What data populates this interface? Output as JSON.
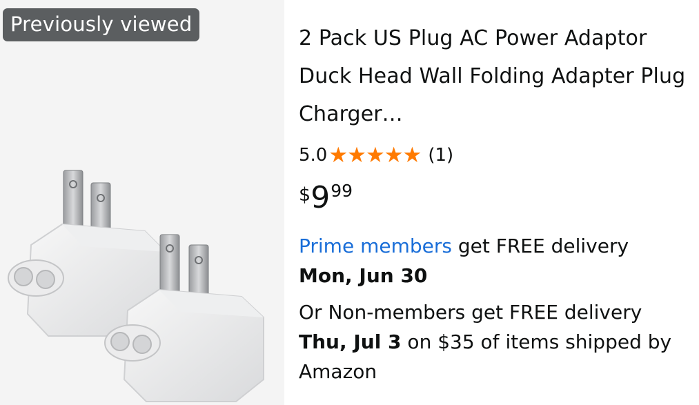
{
  "badge": {
    "label": "Previously viewed"
  },
  "product": {
    "title": "2 Pack US Plug AC Power Adaptor Duck Head Wall Folding Adapter Plug Charger…",
    "rating": "5.0",
    "rating_stars": 5,
    "review_count": "(1)",
    "price": {
      "symbol": "$",
      "whole": "9",
      "fraction": "99"
    }
  },
  "delivery": {
    "prime_link": "Prime members",
    "prime_text": " get FREE delivery",
    "prime_date": "Mon, Jun 30",
    "nonmember_text": "Or Non-members get FREE delivery",
    "nonmember_date": "Thu, Jul 3",
    "nonmember_condition": " on $35 of items shipped by Amazon"
  },
  "colors": {
    "star": "#ff7a00",
    "link": "#1a6ed8",
    "badge_bg": "#5b5e60"
  },
  "icons": [
    "star-icon"
  ]
}
